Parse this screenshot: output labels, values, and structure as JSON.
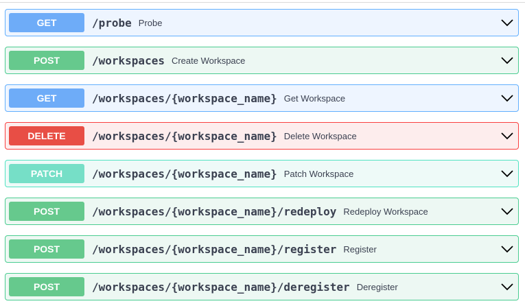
{
  "operations": [
    {
      "method": "GET",
      "path": "/probe",
      "summary": "Probe"
    },
    {
      "method": "POST",
      "path": "/workspaces",
      "summary": "Create Workspace"
    },
    {
      "method": "GET",
      "path": "/workspaces/{workspace_name}",
      "summary": "Get Workspace"
    },
    {
      "method": "DELETE",
      "path": "/workspaces/{workspace_name}",
      "summary": "Delete Workspace"
    },
    {
      "method": "PATCH",
      "path": "/workspaces/{workspace_name}",
      "summary": "Patch Workspace"
    },
    {
      "method": "POST",
      "path": "/workspaces/{workspace_name}/redeploy",
      "summary": "Redeploy Workspace"
    },
    {
      "method": "POST",
      "path": "/workspaces/{workspace_name}/register",
      "summary": "Register"
    },
    {
      "method": "POST",
      "path": "/workspaces/{workspace_name}/deregister",
      "summary": "Deregister"
    }
  ],
  "icons": {
    "expand": "chevron-down-icon"
  },
  "colors": {
    "get": "#61affe",
    "post": "#49cc90",
    "delete": "#f93e3e",
    "patch": "#50e3c2",
    "text": "#3b4151"
  }
}
